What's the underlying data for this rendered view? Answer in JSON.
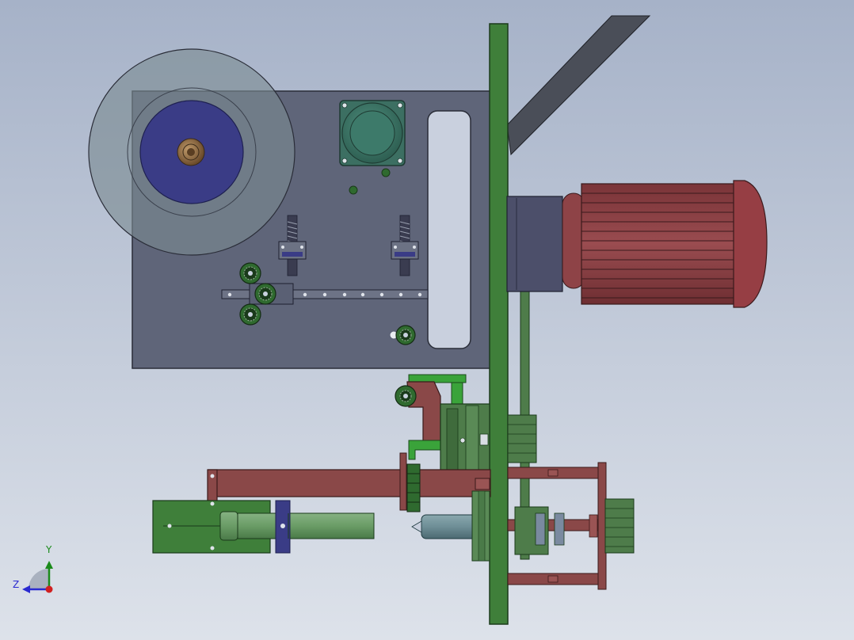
{
  "viewport": {
    "background_top": "#a6b2c8",
    "background_bottom": "#dde2ea"
  },
  "triad": {
    "y_label": "Y",
    "z_label": "Z",
    "y_color": "#1a8a1a",
    "z_color": "#2a2ad0",
    "x_color": "#d02020"
  },
  "colors": {
    "plate": "#5f6579",
    "frame_green": "#3f7f3a",
    "motor_red": "#8e4347",
    "arm_red": "#8a4848",
    "reel_blue": "#3a3c86",
    "guide_roller": "#2f6a2f",
    "cylinder_green": "#5b8a58",
    "stepper": "#3f7c6c",
    "hub_bronze": "#8a6a44"
  }
}
